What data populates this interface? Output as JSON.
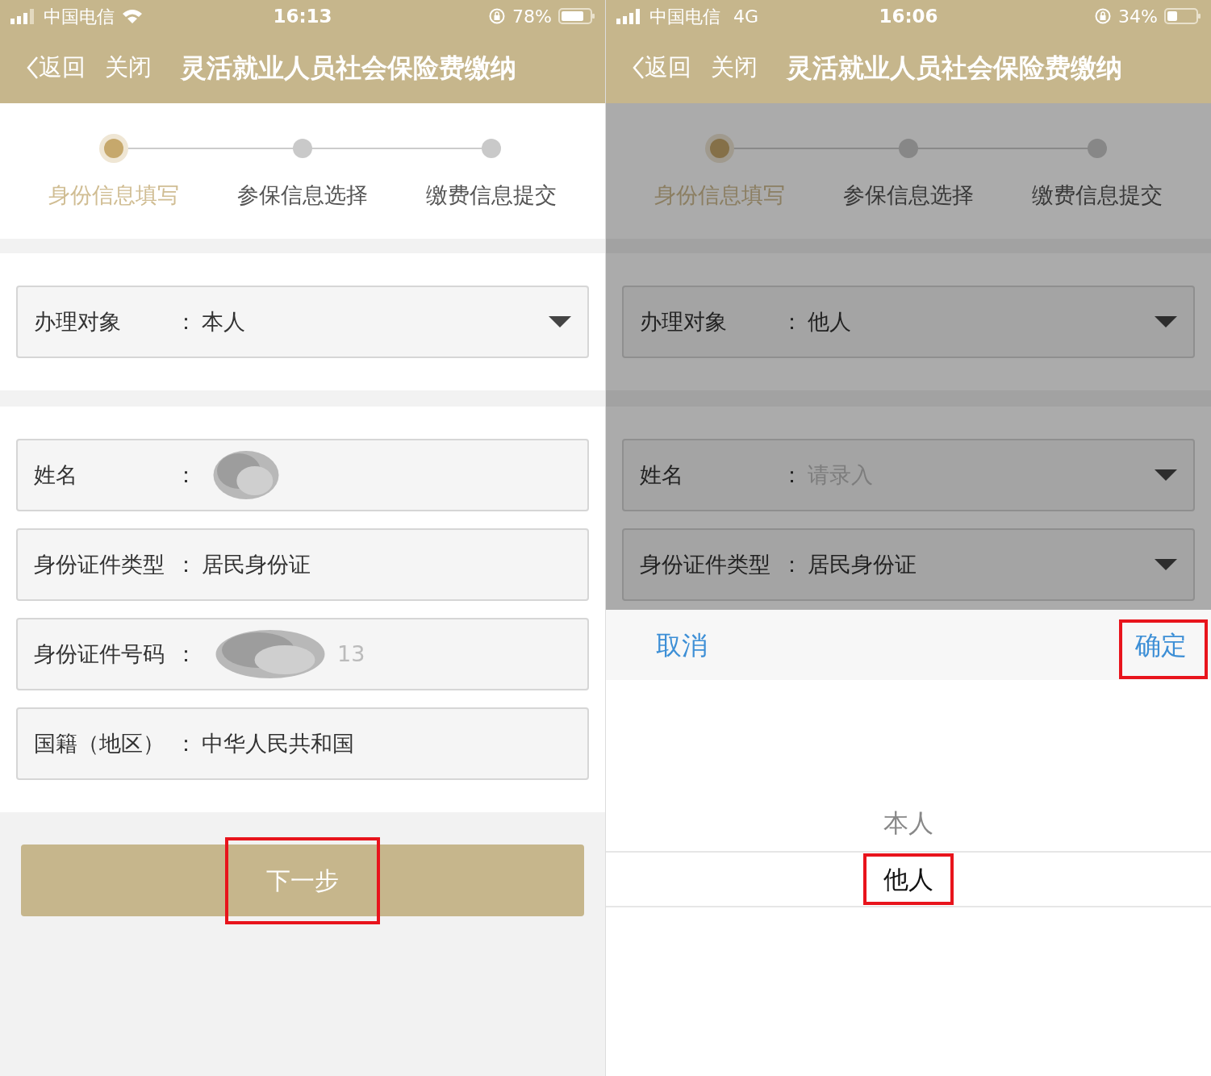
{
  "screens": [
    {
      "status_bar": {
        "carrier": "中国电信",
        "connection": {
          "kind": "wifi"
        },
        "time": "16:13",
        "battery": "78%"
      },
      "nav": {
        "back": "返回",
        "close": "关闭",
        "title": "灵活就业人员社会保险费缴纳"
      },
      "steps": [
        {
          "label": "身份信息填写",
          "selected": true
        },
        {
          "label": "参保信息选择",
          "selected": false
        },
        {
          "label": "缴费信息提交",
          "selected": false
        }
      ],
      "subject_field": {
        "label": "办理对象",
        "colon": "：",
        "value": "本人",
        "dropdown": true
      },
      "fields": [
        {
          "label": "姓名",
          "colon": "：",
          "kind": "redacted",
          "dropdown": false
        },
        {
          "label": "身份证件类型",
          "colon": "：",
          "kind": "value",
          "value": "居民身份证",
          "dropdown": false
        },
        {
          "label": "身份证件号码",
          "colon": "：",
          "kind": "redacted",
          "value": "13",
          "dropdown": false
        },
        {
          "label": "国籍（地区）",
          "colon": "：",
          "kind": "value",
          "value": "中华人民共和国",
          "dropdown": false
        }
      ],
      "next_button": {
        "label": "下一步",
        "highlighted": true
      }
    },
    {
      "status_bar": {
        "carrier": "中国电信",
        "connection": {
          "kind": "text",
          "label": "4G"
        },
        "time": "16:06",
        "battery": "34%"
      },
      "nav": {
        "back": "返回",
        "close": "关闭",
        "title": "灵活就业人员社会保险费缴纳"
      },
      "steps": [
        {
          "label": "身份信息填写",
          "selected": true
        },
        {
          "label": "参保信息选择",
          "selected": false
        },
        {
          "label": "缴费信息提交",
          "selected": false
        }
      ],
      "subject_field": {
        "label": "办理对象",
        "colon": "：",
        "value": "他人",
        "dropdown": true
      },
      "fields": [
        {
          "label": "姓名",
          "colon": "：",
          "kind": "placeholder",
          "placeholder": "请录入",
          "dropdown": true
        },
        {
          "label": "身份证件类型",
          "colon": "：",
          "kind": "value",
          "value": "居民身份证",
          "dropdown": true
        }
      ],
      "picker": {
        "cancel": "取消",
        "confirm": "确定",
        "confirm_highlighted": true,
        "options": [
          {
            "label": "本人",
            "selected": false,
            "highlighted": false
          },
          {
            "label": "他人",
            "selected": true,
            "highlighted": true
          }
        ]
      }
    }
  ]
}
